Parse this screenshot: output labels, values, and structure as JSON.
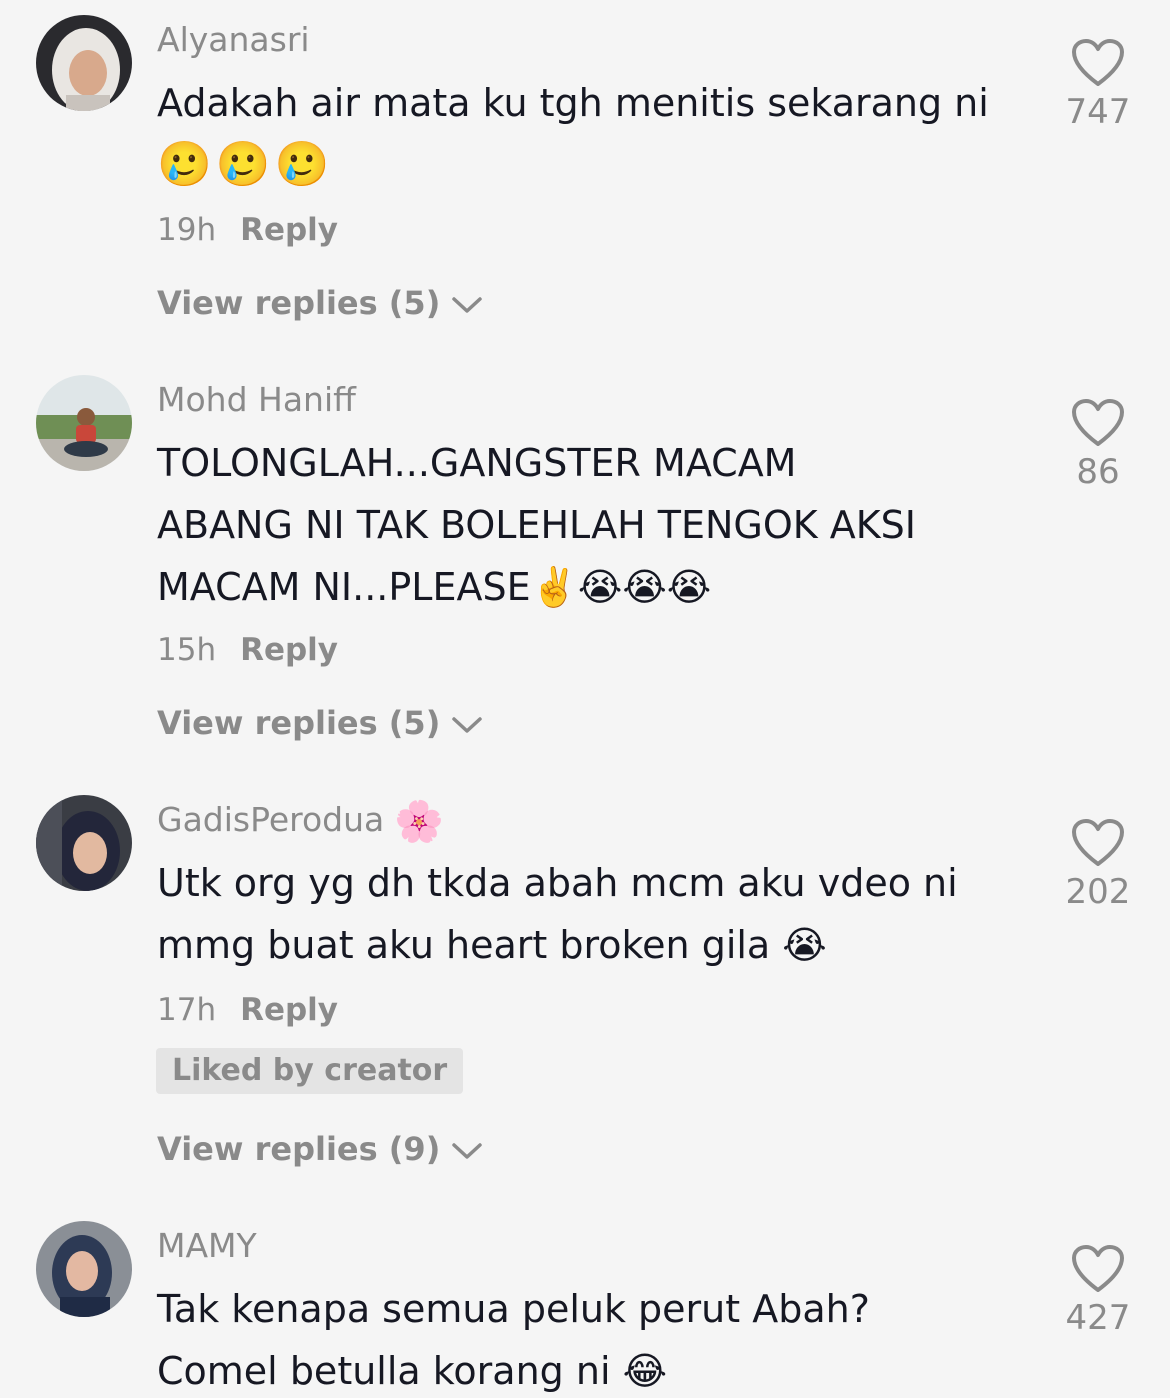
{
  "comments": [
    {
      "username": "Alyanasri",
      "lines": [
        "Adakah air mata ku tgh menitis sekarang ni",
        "🥲🥲🥲"
      ],
      "time": "19h",
      "reply_label": "Reply",
      "view_replies": "View replies (5)",
      "likes": "747"
    },
    {
      "username": "Mohd Haniff",
      "lines": [
        "TOLONGLAH...GANGSTER MACAM",
        "ABANG NI TAK BOLEHLAH TENGOK AKSI",
        "MACAM NI...PLEASE✌️😭😭😭"
      ],
      "time": "15h",
      "reply_label": "Reply",
      "view_replies": "View replies (5)",
      "likes": "86"
    },
    {
      "username": "GadisPerodua",
      "username_emoji": "🌸",
      "lines": [
        "Utk org yg dh tkda abah mcm aku vdeo ni",
        "mmg buat aku heart broken gila 😭"
      ],
      "time": "17h",
      "reply_label": "Reply",
      "badge": "Liked by creator",
      "view_replies": "View replies (9)",
      "likes": "202"
    },
    {
      "username": "MAMY",
      "lines": [
        "Tak kenapa semua peluk perut Abah?",
        "Comel betulla korang ni 😂"
      ],
      "likes": "427"
    }
  ],
  "icons": {
    "like": "heart-outline-icon",
    "expand": "chevron-down-icon"
  },
  "colors": {
    "background": "#f5f5f5",
    "text": "#161823",
    "secondary": "#8a8a8a",
    "badge_bg": "#e4e4e4"
  }
}
